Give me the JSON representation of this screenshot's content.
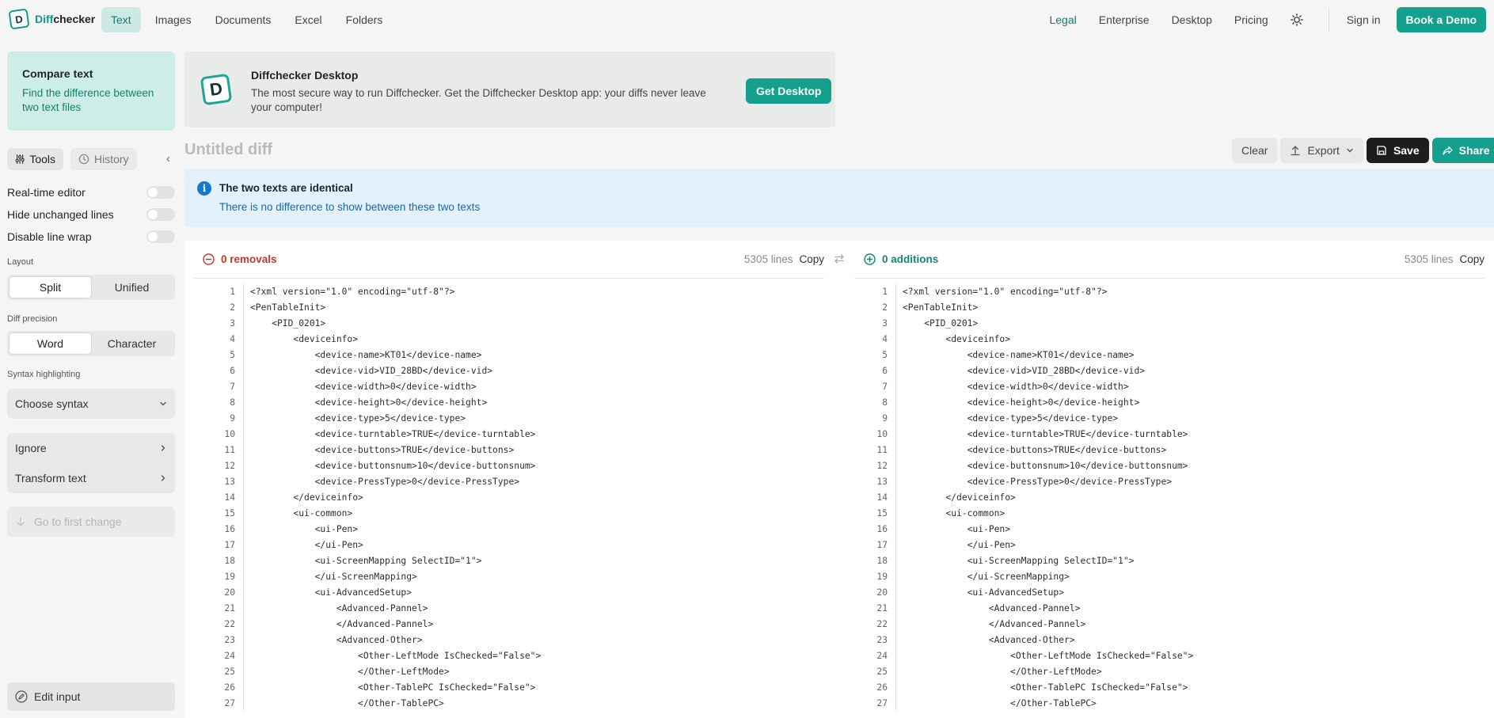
{
  "brand": {
    "name_a": "Diff",
    "name_b": "checker",
    "mark": "D"
  },
  "nav": {
    "left": [
      {
        "label": "Text",
        "active": true
      },
      {
        "label": "Images"
      },
      {
        "label": "Documents"
      },
      {
        "label": "Excel"
      },
      {
        "label": "Folders"
      }
    ],
    "right": [
      {
        "label": "Legal"
      },
      {
        "label": "Enterprise"
      },
      {
        "label": "Desktop"
      },
      {
        "label": "Pricing"
      }
    ],
    "sign_in": "Sign in",
    "book_demo": "Book a Demo"
  },
  "sidebar": {
    "compare_title": "Compare text",
    "compare_sub": "Find the difference between two text files",
    "tab_tools": "Tools",
    "tab_history": "History",
    "toggles": [
      {
        "label": "Real-time editor"
      },
      {
        "label": "Hide unchanged lines"
      },
      {
        "label": "Disable line wrap"
      }
    ],
    "layout_label": "Layout",
    "layout_options": [
      "Split",
      "Unified"
    ],
    "precision_label": "Diff precision",
    "precision_options": [
      "Word",
      "Character"
    ],
    "syntax_label": "Syntax highlighting",
    "syntax_select": "Choose syntax",
    "ignore": "Ignore",
    "transform": "Transform text",
    "first_change": "Go to first change",
    "edit_input": "Edit input"
  },
  "banner": {
    "title": "Diffchecker Desktop",
    "text": "The most secure way to run Diffchecker. Get the Diffchecker Desktop app: your diffs never leave your computer!",
    "button": "Get Desktop"
  },
  "diff": {
    "title": "Untitled diff",
    "actions": {
      "clear": "Clear",
      "export": "Export",
      "save": "Save",
      "share": "Share"
    },
    "info_title": "The two texts are identical",
    "info_sub": "There is no difference to show between these two texts",
    "left": {
      "count": "0 removals",
      "lines": "5305 lines",
      "copy": "Copy"
    },
    "right": {
      "count": "0 additions",
      "lines": "5305 lines",
      "copy": "Copy"
    },
    "code_lines": [
      "<?xml version=\"1.0\" encoding=\"utf-8\"?>",
      "<PenTableInit>",
      "    <PID_0201>",
      "        <deviceinfo>",
      "            <device-name>KT01</device-name>",
      "            <device-vid>VID_28BD</device-vid>",
      "            <device-width>0</device-width>",
      "            <device-height>0</device-height>",
      "            <device-type>5</device-type>",
      "            <device-turntable>TRUE</device-turntable>",
      "            <device-buttons>TRUE</device-buttons>",
      "            <device-buttonsnum>10</device-buttonsnum>",
      "            <device-PressType>0</device-PressType>",
      "        </deviceinfo>",
      "        <ui-common>",
      "            <ui-Pen>",
      "            </ui-Pen>",
      "            <ui-ScreenMapping SelectID=\"1\">",
      "            </ui-ScreenMapping>",
      "            <ui-AdvancedSetup>",
      "                <Advanced-Pannel>",
      "                </Advanced-Pannel>",
      "                <Advanced-Other>",
      "                    <Other-LeftMode IsChecked=\"False\">",
      "                    </Other-LeftMode>",
      "                    <Other-TablePC IsChecked=\"False\">",
      "                    </Other-TablePC>"
    ]
  },
  "colors": {
    "accent": "#14a08d",
    "removal": "#c0392b",
    "addition": "#0f8a74",
    "info_bg": "#e2f1fc"
  }
}
